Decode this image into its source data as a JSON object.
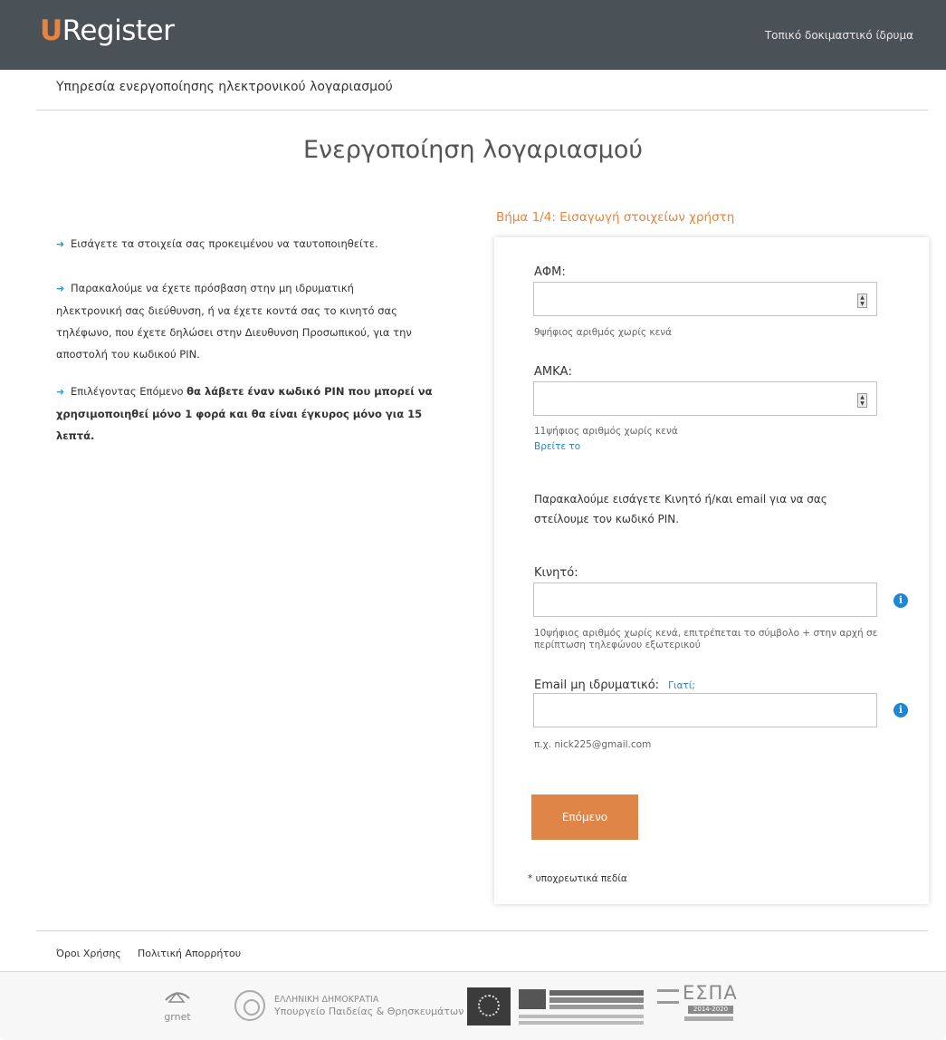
{
  "header": {
    "logo_u": "U",
    "logo_rest": "Register",
    "institution": "Τοπικό δοκιμαστικό ίδρυμα"
  },
  "service_title": "Υπηρεσία ενεργοποίησης ηλεκτρονικού λογαριασμού",
  "page_title": "Ενεργοποίηση λογαριασμού",
  "info": {
    "p1": "Εισάγετε τα στοιχεία σας προκειμένου να ταυτοποιηθείτε.",
    "p2": "Παρακαλούμε να έχετε πρόσβαση στην μη ιδρυματική ηλεκτρονική σας διεύθυνση, ή να έχετε κοντά σας το κινητό σας τηλέφωνο, που έχετε δηλώσει στην Διευθυνση Προσωπικού, για την αποστολή του κωδικού PIN.",
    "p3_prefix": "Επιλέγοντας Επόμενο ",
    "p3_bold": "θα λάβετε έναν κωδικό PIN που μπορεί να χρησιμοποιηθεί μόνο 1 φορά και θα είναι έγκυρος μόνο για 15 λεπτά."
  },
  "step_title": "Βήμα 1/4: Εισαγωγή στοιχείων χρήστη",
  "form": {
    "afm_label": "ΑΦΜ:",
    "afm_value": "",
    "afm_hint": "9ψήφιος αριθμός χωρίς κενά",
    "amka_label": "ΑΜΚΑ:",
    "amka_value": "",
    "amka_hint": "11ψήφιος αριθμός χωρίς κενά",
    "amka_find_link": "Βρείτε το",
    "notice": "Παρακαλούμε εισάγετε Κινητό ή/και email για να σας στείλουμε τον κωδικό PIN.",
    "mobile_label": "Κινητό:",
    "mobile_value": "",
    "mobile_hint": "10ψήφιος αριθμός χωρίς κενά, επιτρέπεται το σύμβολο + στην αρχή σε περίπτωση τηλεφώνου εξωτερικού",
    "email_label": "Email μη ιδρυματικό:",
    "email_why_link": "Γιατί;",
    "email_value": "",
    "email_hint": "π.χ. nick225@gmail.com",
    "next_button": "Επόμενο",
    "required_note": "* υποχρεωτικά πεδία"
  },
  "footer": {
    "terms": "Όροι Χρήσης",
    "privacy": "Πολιτική Απορρήτου"
  },
  "logos": {
    "grnet": "grnet",
    "gov_line1": "ΕΛΛΗΝΙΚΗ ΔΗΜΟΚΡΑΤΙΑ",
    "gov_line2": "Υπουργείο Παιδείας & Θρησκευμάτων",
    "espa": "ΕΣΠΑ",
    "espa_years": "2014-2020"
  },
  "colors": {
    "topbar": "#4a5157",
    "accent": "#e8843c",
    "button": "#e08548",
    "link": "#2a86c7",
    "info_icon": "#1c87d6"
  }
}
